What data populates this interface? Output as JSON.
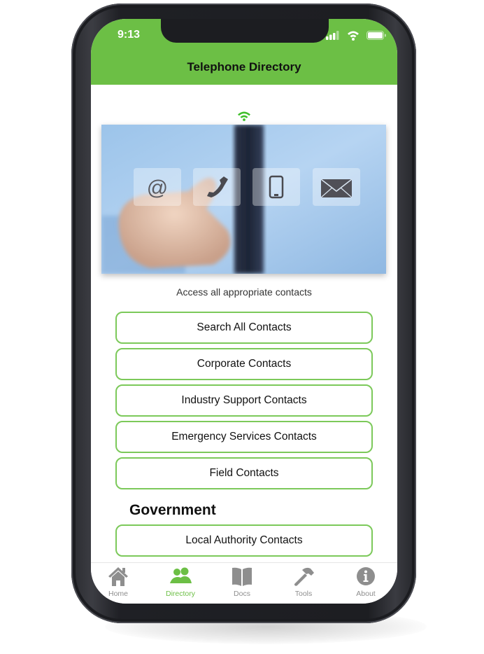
{
  "device": {
    "status_bar": {
      "time": "9:13",
      "icons": [
        "cellular-signal-icon",
        "wifi-icon",
        "battery-icon"
      ]
    }
  },
  "colors": {
    "accent": "#6cbf45",
    "button_border": "#7cc95a",
    "tab_inactive": "#8e8e8e"
  },
  "header": {
    "title": "Telephone Directory"
  },
  "content": {
    "connection_icon": "wifi-icon",
    "hero_icons": [
      "at-sign-icon",
      "telephone-icon",
      "mobile-phone-icon",
      "envelope-icon"
    ],
    "caption": "Access all appropriate contacts",
    "buttons": [
      {
        "label": "Search All Contacts"
      },
      {
        "label": "Corporate Contacts"
      },
      {
        "label": "Industry Support Contacts"
      },
      {
        "label": "Emergency Services Contacts"
      },
      {
        "label": "Field Contacts"
      }
    ],
    "sections": [
      {
        "title": "Government",
        "buttons": [
          {
            "label": "Local Authority Contacts"
          }
        ]
      }
    ]
  },
  "tabbar": {
    "items": [
      {
        "label": "Home",
        "icon": "home-icon",
        "active": false
      },
      {
        "label": "Directory",
        "icon": "people-icon",
        "active": true
      },
      {
        "label": "Docs",
        "icon": "book-icon",
        "active": false
      },
      {
        "label": "Tools",
        "icon": "hammer-icon",
        "active": false
      },
      {
        "label": "About",
        "icon": "info-icon",
        "active": false
      }
    ]
  }
}
